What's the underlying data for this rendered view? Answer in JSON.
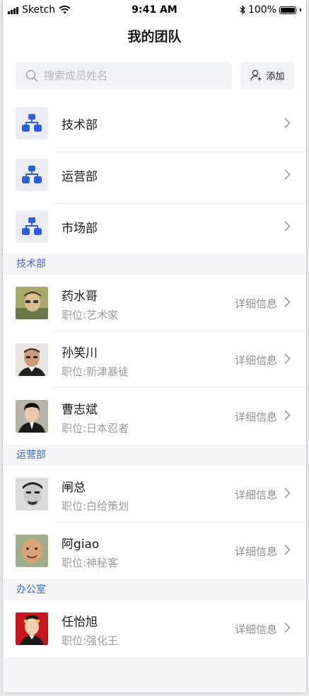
{
  "status_bar": {
    "carrier": "Sketch",
    "time": "9:41 AM",
    "battery": "100%"
  },
  "nav": {
    "title": "我的团队"
  },
  "search": {
    "placeholder": "搜索成员姓名",
    "value": ""
  },
  "add_button": {
    "label": "添加"
  },
  "departments": [
    {
      "name": "技术部"
    },
    {
      "name": "运营部"
    },
    {
      "name": "市场部"
    }
  ],
  "groups": [
    {
      "title": "技术部",
      "members": [
        {
          "name": "药水哥",
          "position": "职位:艺术家",
          "detail": "详细信息"
        },
        {
          "name": "孙笑川",
          "position": "职位:新津暴徒",
          "detail": "详细信息"
        },
        {
          "name": "曹志斌",
          "position": "职位:日本忍者",
          "detail": "详细信息"
        }
      ]
    },
    {
      "title": "运营部",
      "members": [
        {
          "name": "闸总",
          "position": "职位:白给策划",
          "detail": "详细信息"
        },
        {
          "name": "阿giao",
          "position": "职位:神秘客",
          "detail": "详细信息"
        }
      ]
    },
    {
      "title": "办公室",
      "members": [
        {
          "name": "任怡旭",
          "position": "职位:强化王",
          "detail": "详细信息"
        }
      ]
    }
  ],
  "colors": {
    "accent": "#3d67c9",
    "icon_blue": "#2f5fd6",
    "background": "#f5f5f7"
  }
}
